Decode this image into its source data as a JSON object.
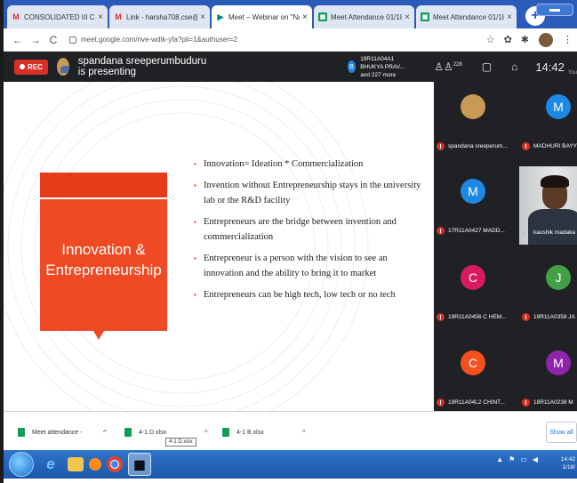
{
  "browser": {
    "tabs": [
      {
        "icon": "M",
        "title": "CONSOLIDATED III CSE D ATTE",
        "close": "×"
      },
      {
        "icon": "M",
        "title": "Link - harsha708.cse@gcet.edu",
        "close": "×"
      },
      {
        "icon": "▶",
        "title": "Meet – Webinar on \"Natio",
        "close": "×"
      },
      {
        "icon": "▦",
        "title": "Meet Attendance 01/18/2021 -",
        "close": "×"
      },
      {
        "icon": "▦",
        "title": "Meet Attendance 01/18/2021 -",
        "close": "×"
      }
    ],
    "new_tab": "+",
    "url": "meet.google.com/nve-wdtk-yfa?pli=1&authuser=2",
    "nav": {
      "back": "←",
      "forward": "→",
      "reload": "C"
    },
    "right_icons": {
      "star": "☆",
      "ext1": "✿",
      "ext2": "✱",
      "menu": "⋮"
    }
  },
  "meet": {
    "rec_label": "REC",
    "presenting": "spandana sreeperumbuduru is presenting",
    "participants_pill": {
      "initial": "B",
      "line1": "19R11A04A1 BHUKYA PRAV...",
      "line2": "and 227 more"
    },
    "people_count": "228",
    "time": "14:42",
    "you_label": "You"
  },
  "slide": {
    "title_line1": "Innovation &",
    "title_line2": "Entrepreneurship",
    "bullets": [
      "Innovation= Ideation * Commercialization",
      "Invention without Entrepreneurship stays in the university lab or the R&D facility",
      "Entrepreneurs are the bridge between invention and commercialization",
      "Entrepreneur is a person with the vision to see an innovation and the ability to bring it to market",
      "Entrepreneurs can be high tech, low tech or no tech"
    ],
    "accent_color": "#f04a24"
  },
  "participants": [
    {
      "initial": "",
      "name": "spandana sreeperum...",
      "color": "#c89a55"
    },
    {
      "initial": "M",
      "name": "MADHURI BAYY",
      "color": "#1e88e5"
    },
    {
      "initial": "M",
      "name": "17R11A0427 MADD...",
      "color": "#1e88e5"
    },
    {
      "initial": "",
      "name": "kaushik madaka",
      "color": ""
    },
    {
      "initial": "C",
      "name": "19R11A0456 C HEM...",
      "color": "#d81b60"
    },
    {
      "initial": "J",
      "name": "19R11A0358 JA",
      "color": "#43a047"
    },
    {
      "initial": "C",
      "name": "19R11A04L2 CHINT...",
      "color": "#f4511e"
    },
    {
      "initial": "M",
      "name": "18R11A0238 M",
      "color": "#8e24aa"
    }
  ],
  "downloads": {
    "items": [
      "Meet attendance -",
      "4-1 D.xlsx",
      "4-1 B.xlsx"
    ],
    "tooltip": "4-1 D.xlsx",
    "chevron": "^",
    "show_all": "Show all"
  },
  "taskbar": {
    "ie_glyph": "e",
    "tray": {
      "arrow": "▲",
      "flag": "⚑",
      "net": "▭",
      "vol": "◀"
    },
    "clock_line1": "14:42",
    "clock_line2": "1/18/"
  }
}
